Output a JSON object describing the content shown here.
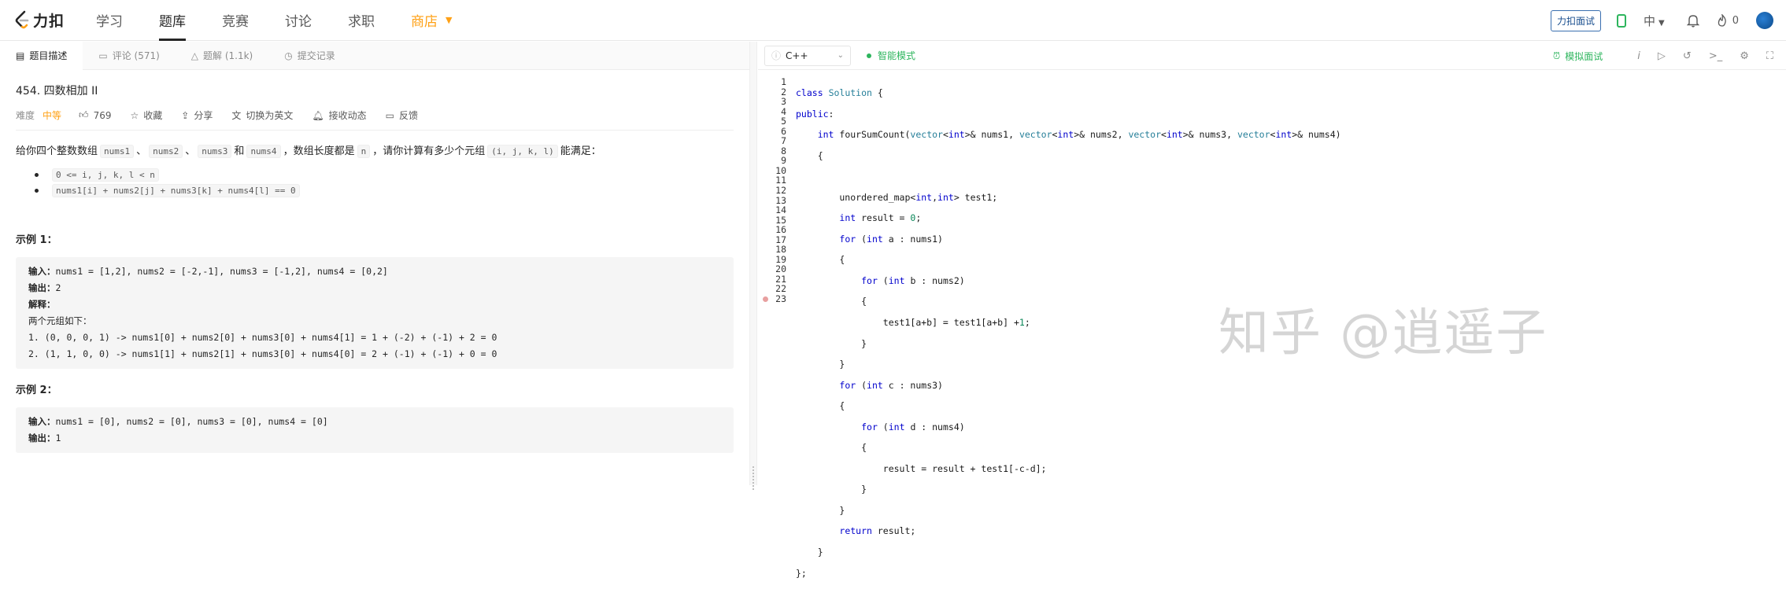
{
  "nav": {
    "logo_text": "力扣",
    "items": [
      "学习",
      "题库",
      "竞赛",
      "讨论",
      "求职"
    ],
    "shop": "商店",
    "mock_button": "力扣面试",
    "lang": "中",
    "points": "0"
  },
  "tabs": [
    "题目描述",
    "评论 (571)",
    "题解 (1.1k)",
    "提交记录"
  ],
  "problem": {
    "title": "454. 四数相加 II",
    "difficulty_label": "难度",
    "difficulty": "中等",
    "likes": "769",
    "actions": [
      "收藏",
      "分享",
      "切换为英文",
      "接收动态",
      "反馈"
    ],
    "desc_prefix": "给你四个整数数组",
    "nums1": "nums1",
    "sep": "、",
    "nums2": "nums2",
    "nums3": "nums3",
    "and": "和",
    "nums4": "nums4",
    "desc_mid": "，数组长度都是",
    "n": "n",
    "desc_mid2": "，请你计算有多少个元组",
    "tuple": "(i, j, k, l)",
    "desc_suffix": "能满足：",
    "bullets": [
      "0 <= i, j, k, l < n",
      "nums1[i] + nums2[j] + nums3[k] + nums4[l] == 0"
    ],
    "example1_title": "示例 1：",
    "example1": {
      "input_label": "输入：",
      "input": "nums1 = [1,2], nums2 = [-2,-1], nums3 = [-1,2], nums4 = [0,2]",
      "output_label": "输出：",
      "output": "2",
      "explain_label": "解释：",
      "explain1": "两个元组如下：",
      "explain2": "1. (0, 0, 0, 1) -> nums1[0] + nums2[0] + nums3[0] + nums4[1] = 1 + (-2) + (-1) + 2 = 0",
      "explain3": "2. (1, 1, 0, 0) -> nums1[1] + nums2[1] + nums3[0] + nums4[0] = 2 + (-1) + (-1) + 0 = 0"
    },
    "example2_title": "示例 2：",
    "example2": {
      "input_label": "输入：",
      "input": "nums1 = [0], nums2 = [0], nums3 = [0], nums4 = [0]",
      "output_label": "输出：",
      "output": "1"
    }
  },
  "editor": {
    "language": "C++",
    "smart_mode": "智能模式",
    "mock_interview": "模拟面试",
    "line_numbers": [
      "1",
      "2",
      "3",
      "4",
      "5",
      "6",
      "7",
      "8",
      "9",
      "10",
      "11",
      "12",
      "13",
      "14",
      "15",
      "16",
      "17",
      "18",
      "19",
      "20",
      "21",
      "22",
      "23"
    ],
    "watermark": "知乎 @逍遥子"
  }
}
